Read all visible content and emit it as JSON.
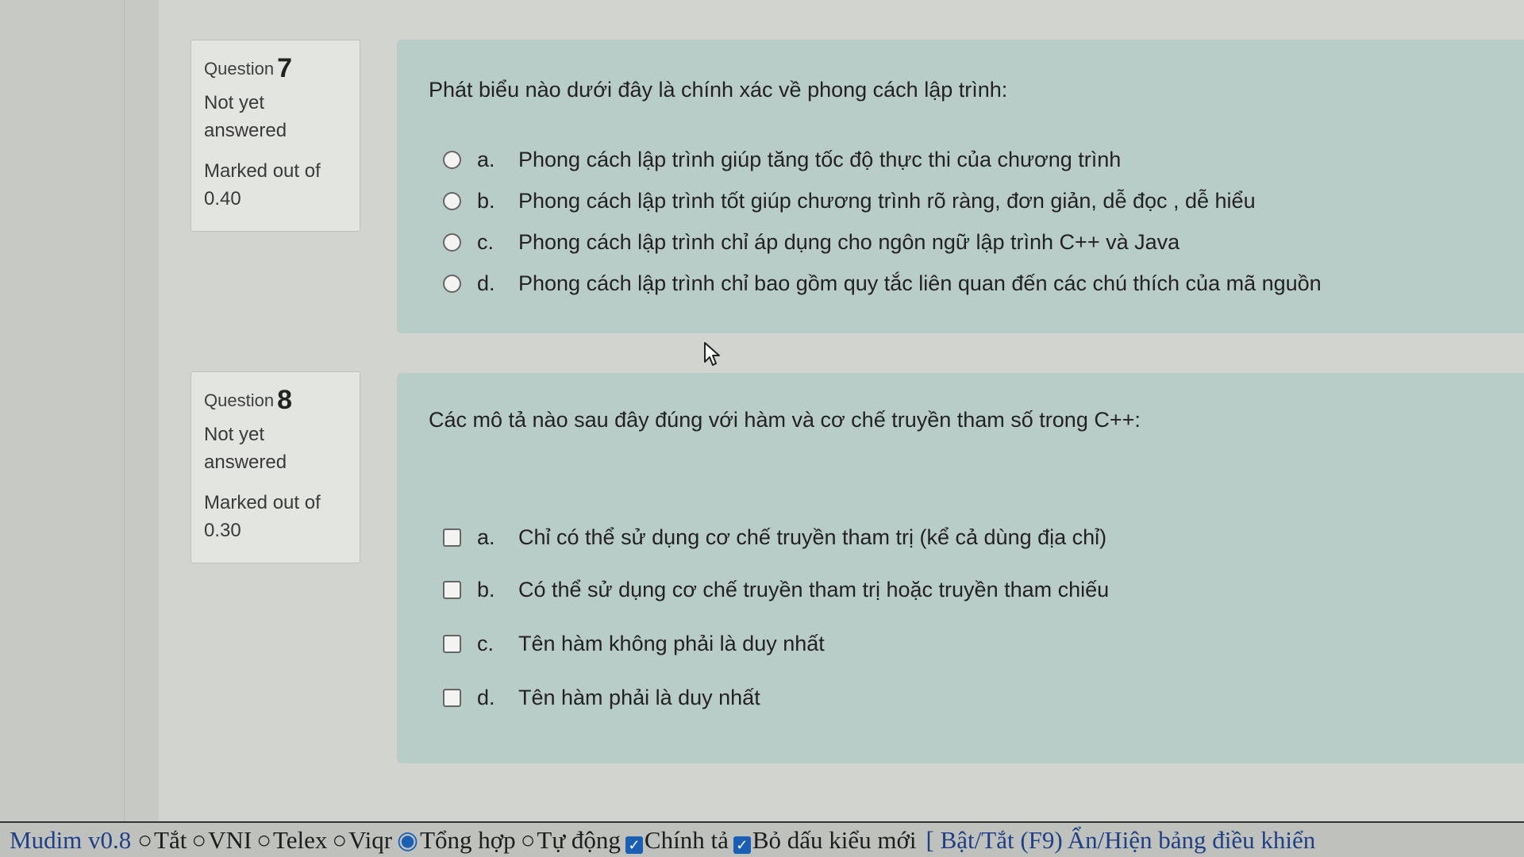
{
  "questions": [
    {
      "label": "Question",
      "number": "7",
      "state": "Not yet answered",
      "mark_label": "Marked out of",
      "mark": "0.40",
      "text": "Phát biểu nào dưới đây là chính xác về phong cách lập trình:",
      "input_type": "radio",
      "answers": [
        {
          "letter": "a.",
          "text": "Phong cách lập trình giúp tăng tốc độ thực thi của chương trình"
        },
        {
          "letter": "b.",
          "text": "Phong cách lập trình tốt giúp chương trình rõ ràng, đơn giản, dễ đọc , dễ hiểu"
        },
        {
          "letter": "c.",
          "text": "Phong cách lập trình chỉ áp dụng cho ngôn ngữ lập trình C++ và Java"
        },
        {
          "letter": "d.",
          "text": "Phong cách lập trình chỉ bao gồm quy tắc liên quan đến các chú thích của mã nguồn"
        }
      ]
    },
    {
      "label": "Question",
      "number": "8",
      "state": "Not yet answered",
      "mark_label": "Marked out of",
      "mark": "0.30",
      "text": "Các mô tả nào sau đây đúng với hàm và cơ chế truyền tham số trong C++:",
      "input_type": "checkbox",
      "answers": [
        {
          "letter": "a.",
          "text": "Chỉ có thể sử dụng cơ chế truyền tham trị (kể cả dùng địa chỉ)"
        },
        {
          "letter": "b.",
          "text": "Có thể sử dụng cơ chế truyền tham trị hoặc truyền tham chiếu"
        },
        {
          "letter": "c.",
          "text": "Tên hàm không phải là duy nhất"
        },
        {
          "letter": "d.",
          "text": "Tên hàm phải là duy nhất"
        }
      ]
    }
  ],
  "mudim": {
    "title": "Mudim v0.8",
    "options": [
      "Tắt",
      "VNI",
      "Telex",
      "Viqr",
      "Tổng hợp",
      "Tự động"
    ],
    "selected": "Tổng hợp",
    "checks": [
      "Chính tả",
      "Bỏ dấu kiểu mới"
    ],
    "toggle_link": "[ Bật/Tắt (F9)",
    "panel_link": "Ẩn/Hiện bảng điều khiển"
  }
}
